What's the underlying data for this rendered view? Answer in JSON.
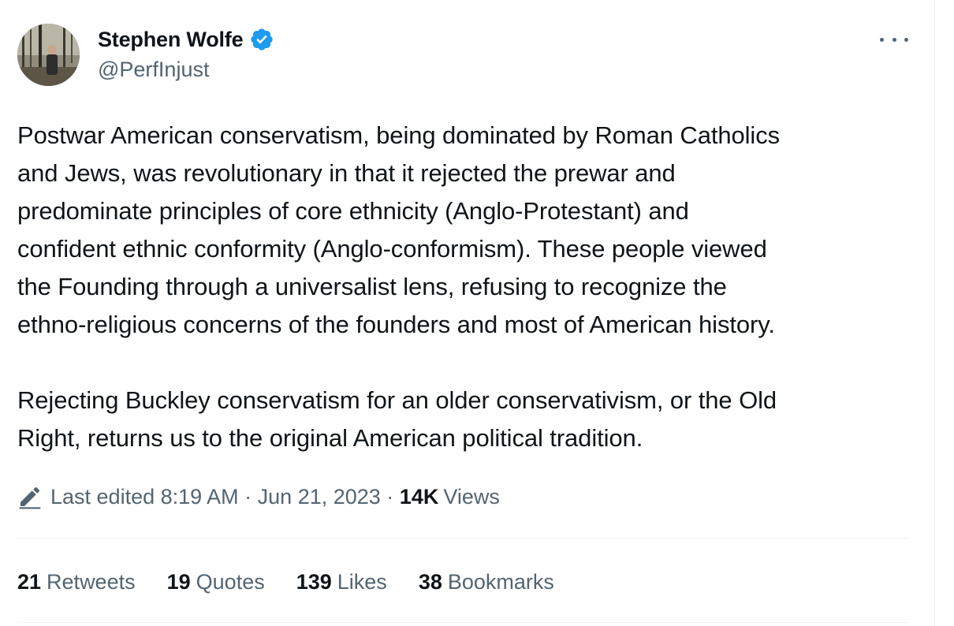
{
  "author": {
    "display_name": "Stephen Wolfe",
    "handle": "@PerfInjust",
    "verified": true,
    "verified_color": "#1d9bf0"
  },
  "tweet": {
    "paragraph1": [
      "Postwar American conservatism, being dominated by Roman Catholics",
      "and Jews, was revolutionary in that it rejected the prewar and",
      "predominate principles of core ethnicity (Anglo-Protestant) and",
      "confident ethnic conformity (Anglo-conformism). These people viewed",
      "the Founding through a universalist lens, refusing to recognize the",
      "ethno-religious concerns of the founders and most of American history."
    ],
    "paragraph2": [
      "Rejecting Buckley conservatism for an older conservativism, or the Old",
      "Right, returns us to the original American political tradition."
    ]
  },
  "meta": {
    "edited_label": "Last edited 8:19 AM · Jun 21, 2023 · ",
    "views_count": "14K",
    "views_label": "Views",
    "edit_icon": "pencil-icon"
  },
  "stats": [
    {
      "count": "21",
      "label": "Retweets"
    },
    {
      "count": "19",
      "label": "Quotes"
    },
    {
      "count": "139",
      "label": "Likes"
    },
    {
      "count": "38",
      "label": "Bookmarks"
    }
  ],
  "colors": {
    "text_primary": "#0f1419",
    "text_secondary": "#536471",
    "divider": "#eff3f4"
  }
}
